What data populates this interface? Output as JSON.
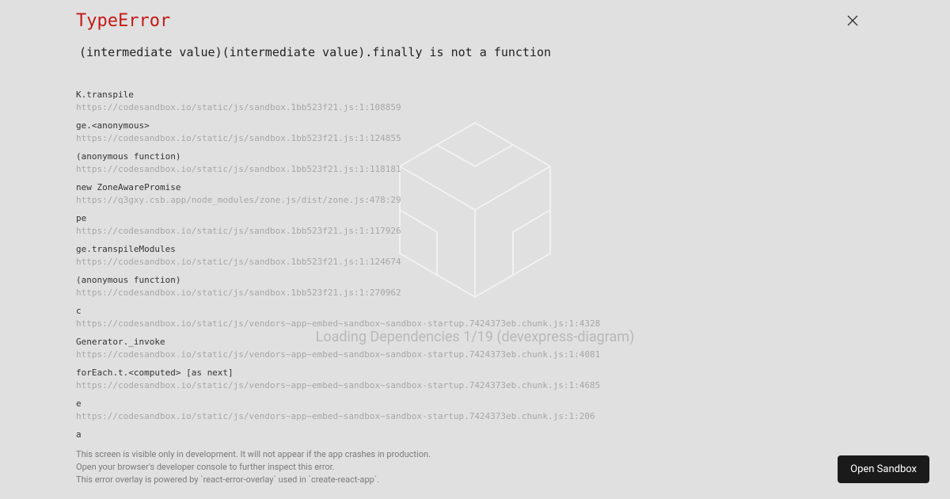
{
  "background": {
    "loadingText": "Loading Dependencies 1/19 (devexpress-diagram)"
  },
  "error": {
    "type": "TypeError",
    "message": "(intermediate value)(intermediate value).finally is not a function",
    "frames": [
      {
        "fn": "K.transpile",
        "loc": "https://codesandbox.io/static/js/sandbox.1bb523f21.js:1:108859"
      },
      {
        "fn": "ge.<anonymous>",
        "loc": "https://codesandbox.io/static/js/sandbox.1bb523f21.js:1:124855"
      },
      {
        "fn": "(anonymous function)",
        "loc": "https://codesandbox.io/static/js/sandbox.1bb523f21.js:1:118181"
      },
      {
        "fn": "new ZoneAwarePromise",
        "loc": "https://q3gxy.csb.app/node_modules/zone.js/dist/zone.js:478:29"
      },
      {
        "fn": "pe",
        "loc": "https://codesandbox.io/static/js/sandbox.1bb523f21.js:1:117926"
      },
      {
        "fn": "ge.transpileModules",
        "loc": "https://codesandbox.io/static/js/sandbox.1bb523f21.js:1:124674"
      },
      {
        "fn": "(anonymous function)",
        "loc": "https://codesandbox.io/static/js/sandbox.1bb523f21.js:1:270962"
      },
      {
        "fn": "c",
        "loc": "https://codesandbox.io/static/js/vendors~app~embed~sandbox~sandbox-startup.7424373eb.chunk.js:1:4328"
      },
      {
        "fn": "Generator._invoke",
        "loc": "https://codesandbox.io/static/js/vendors~app~embed~sandbox~sandbox-startup.7424373eb.chunk.js:1:4081"
      },
      {
        "fn": "forEach.t.<computed> [as next]",
        "loc": "https://codesandbox.io/static/js/vendors~app~embed~sandbox~sandbox-startup.7424373eb.chunk.js:1:4685"
      },
      {
        "fn": "e",
        "loc": "https://codesandbox.io/static/js/vendors~app~embed~sandbox~sandbox-startup.7424373eb.chunk.js:1:206"
      },
      {
        "fn": "a",
        "loc": ""
      }
    ],
    "footer": [
      "This screen is visible only in development. It will not appear if the app crashes in production.",
      "Open your browser's developer console to further inspect this error.",
      "This error overlay is powered by `react-error-overlay` used in `create-react-app`."
    ]
  },
  "openSandbox": {
    "label": "Open Sandbox"
  }
}
